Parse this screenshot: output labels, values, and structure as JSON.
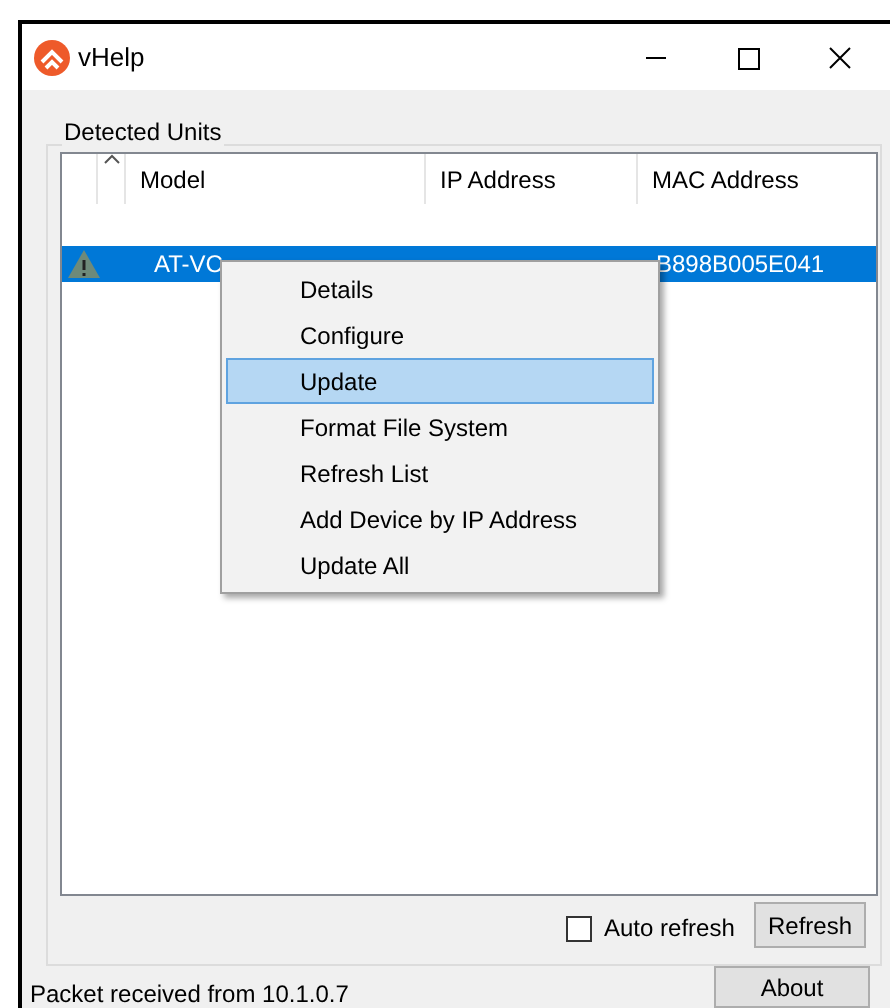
{
  "window": {
    "title": "vHelp"
  },
  "group": {
    "title": "Detected Units"
  },
  "table": {
    "columns": [
      "Model",
      "IP Address",
      "MAC Address"
    ],
    "rows": [
      {
        "model": "AT-VC",
        "mac": "B898B005E041",
        "selected": true
      }
    ]
  },
  "context_menu": [
    {
      "label": "Details",
      "selected": false
    },
    {
      "label": "Configure",
      "selected": false
    },
    {
      "label": "Update",
      "selected": true
    },
    {
      "label": "Format File System",
      "selected": false
    },
    {
      "label": "Refresh List",
      "selected": false
    },
    {
      "label": "Add Device by IP Address",
      "selected": false
    },
    {
      "label": "Update All",
      "selected": false
    }
  ],
  "auto_refresh": {
    "label": "Auto refresh",
    "checked": false
  },
  "buttons": {
    "refresh": "Refresh",
    "about": "About"
  },
  "status": "Packet received from 10.1.0.7"
}
